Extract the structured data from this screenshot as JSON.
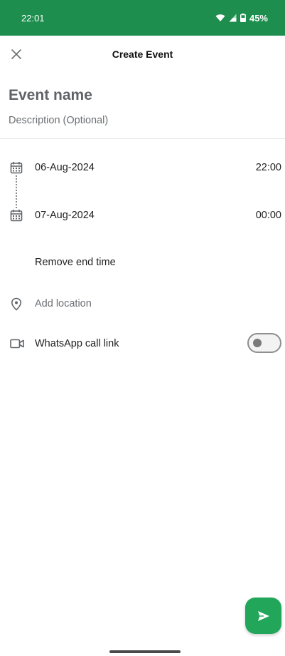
{
  "status_bar": {
    "time": "22:01",
    "battery": "45%"
  },
  "app_bar": {
    "title": "Create Event",
    "close_icon": "close-icon"
  },
  "form": {
    "event_name_placeholder": "Event name",
    "description_placeholder": "Description (Optional)",
    "start": {
      "date": "06-Aug-2024",
      "time": "22:00"
    },
    "end": {
      "date": "07-Aug-2024",
      "time": "00:00"
    },
    "remove_end_time_label": "Remove end time",
    "location_placeholder": "Add location",
    "call_link_label": "WhatsApp call link",
    "call_link_enabled": false
  },
  "icons": {
    "start_date": "calendar-icon",
    "end_date": "calendar-icon",
    "location": "location-pin-icon",
    "call": "video-camera-icon",
    "send": "send-icon"
  },
  "colors": {
    "status_bar": "#1e8e4e",
    "fab": "#21a65a"
  }
}
